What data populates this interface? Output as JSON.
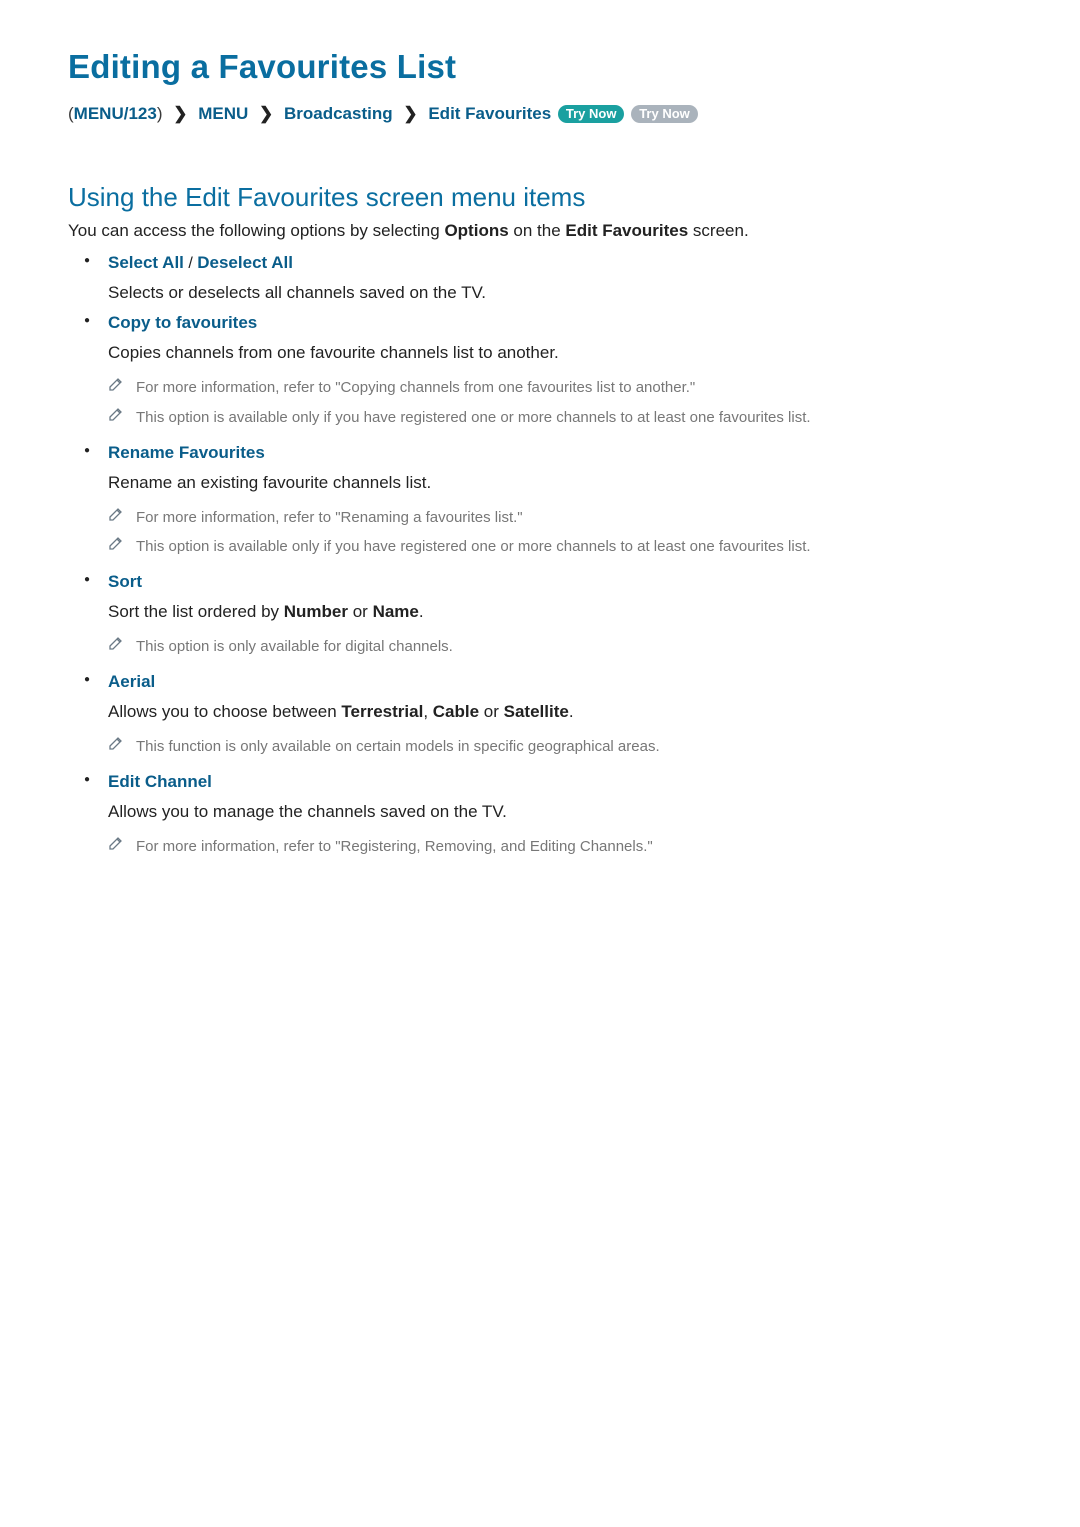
{
  "page_title": "Editing a Favourites List",
  "breadcrumb": {
    "prefix_paren": "(",
    "suffix_paren": ")",
    "root_button": "MENU/123",
    "items": [
      "MENU",
      "Broadcasting",
      "Edit Favourites"
    ],
    "try_now_label": "Try Now"
  },
  "section_heading": "Using the Edit Favourites screen menu items",
  "intro": {
    "pre": "You can access the following options by selecting ",
    "options_word": "Options",
    "mid": " on the ",
    "screen_name": "Edit Favourites",
    "post": " screen."
  },
  "options": [
    {
      "labels": [
        "Select All",
        "Deselect All"
      ],
      "label_separator": " / ",
      "desc": "Selects or deselects all channels saved on the TV.",
      "notes": []
    },
    {
      "labels": [
        "Copy to favourites"
      ],
      "desc": "Copies channels from one favourite channels list to another.",
      "notes": [
        "For more information, refer to \"Copying channels from one favourites list to another.\"",
        "This option is available only if you have registered one or more channels to at least one favourites list."
      ]
    },
    {
      "labels": [
        "Rename Favourites"
      ],
      "desc": "Rename an existing favourite channels list.",
      "notes": [
        "For more information, refer to \"Renaming a favourites list.\"",
        "This option is available only if you have registered one or more channels to at least one favourites list."
      ]
    },
    {
      "labels": [
        "Sort"
      ],
      "desc_parts": {
        "pre": "Sort the list ordered by ",
        "strong1": "Number",
        "mid": " or ",
        "strong2": "Name",
        "post": "."
      },
      "notes": [
        "This option is only available for digital channels."
      ]
    },
    {
      "labels": [
        "Aerial"
      ],
      "desc_parts": {
        "pre": "Allows you to choose between ",
        "strong1": "Terrestrial",
        "sep1": ", ",
        "strong2": "Cable",
        "mid": " or ",
        "strong3": "Satellite",
        "post": "."
      },
      "notes": [
        "This function is only available on certain models in specific geographical areas."
      ]
    },
    {
      "labels": [
        "Edit Channel"
      ],
      "desc": "Allows you to manage the channels saved on the TV.",
      "notes": [
        "For more information, refer to \"Registering, Removing, and Editing Channels.\""
      ]
    }
  ]
}
